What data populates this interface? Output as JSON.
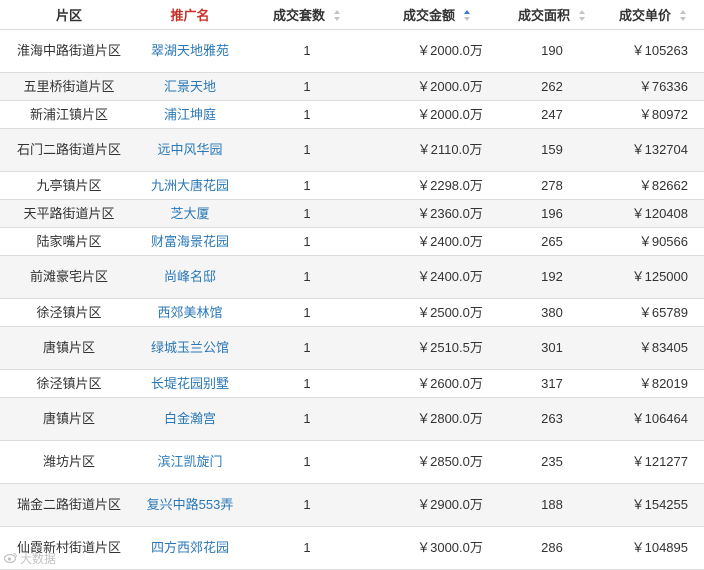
{
  "headers": {
    "district": "片区",
    "project": "推广名",
    "units": "成交套数",
    "amount": "成交金额",
    "area": "成交面积",
    "unit_price": "成交单价"
  },
  "sort": {
    "column": "amount",
    "direction": "ascending"
  },
  "colors": {
    "selected_header": "#c8322a",
    "link": "#2b78b8",
    "sort_active": "#2f7fcf",
    "stripe": "#f5f5f5"
  },
  "rows": [
    {
      "district": "淮海中路街道片区",
      "project": "翠湖天地雅苑",
      "units": "1",
      "amount": "￥2000.0万",
      "area": "190",
      "unit_price": "￥105263"
    },
    {
      "district": "五里桥街道片区",
      "project": "汇景天地",
      "units": "1",
      "amount": "￥2000.0万",
      "area": "262",
      "unit_price": "￥76336"
    },
    {
      "district": "新浦江镇片区",
      "project": "浦江坤庭",
      "units": "1",
      "amount": "￥2000.0万",
      "area": "247",
      "unit_price": "￥80972"
    },
    {
      "district": "石门二路街道片区",
      "project": "远中风华园",
      "units": "1",
      "amount": "￥2110.0万",
      "area": "159",
      "unit_price": "￥132704"
    },
    {
      "district": "九亭镇片区",
      "project": "九洲大唐花园",
      "units": "1",
      "amount": "￥2298.0万",
      "area": "278",
      "unit_price": "￥82662"
    },
    {
      "district": "天平路街道片区",
      "project": "芝大厦",
      "units": "1",
      "amount": "￥2360.0万",
      "area": "196",
      "unit_price": "￥120408"
    },
    {
      "district": "陆家嘴片区",
      "project": "财富海景花园",
      "units": "1",
      "amount": "￥2400.0万",
      "area": "265",
      "unit_price": "￥90566"
    },
    {
      "district": "前滩豪宅片区",
      "project": "尚峰名邸",
      "units": "1",
      "amount": "￥2400.0万",
      "area": "192",
      "unit_price": "￥125000"
    },
    {
      "district": "徐泾镇片区",
      "project": "西郊美林馆",
      "units": "1",
      "amount": "￥2500.0万",
      "area": "380",
      "unit_price": "￥65789"
    },
    {
      "district": "唐镇片区",
      "project": "绿城玉兰公馆",
      "units": "1",
      "amount": "￥2510.5万",
      "area": "301",
      "unit_price": "￥83405"
    },
    {
      "district": "徐泾镇片区",
      "project": "长堤花园别墅",
      "units": "1",
      "amount": "￥2600.0万",
      "area": "317",
      "unit_price": "￥82019"
    },
    {
      "district": "唐镇片区",
      "project": "白金瀚宫",
      "units": "1",
      "amount": "￥2800.0万",
      "area": "263",
      "unit_price": "￥106464"
    },
    {
      "district": "潍坊片区",
      "project": "滨江凯旋门",
      "units": "1",
      "amount": "￥2850.0万",
      "area": "235",
      "unit_price": "￥121277"
    },
    {
      "district": "瑞金二路街道片区",
      "project": "复兴中路553弄",
      "units": "1",
      "amount": "￥2900.0万",
      "area": "188",
      "unit_price": "￥154255"
    },
    {
      "district": "仙霞新村街道片区",
      "project": "四方西郊花园",
      "units": "1",
      "amount": "￥3000.0万",
      "area": "286",
      "unit_price": "￥104895"
    }
  ],
  "watermark": {
    "icon": "weibo-logo-icon",
    "text": "大数据"
  }
}
